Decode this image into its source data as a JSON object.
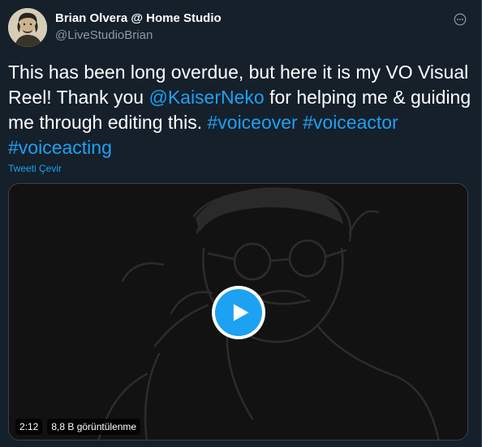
{
  "author": {
    "name": "Brian Olvera @ Home Studio",
    "handle": "@LiveStudioBrian"
  },
  "tweet": {
    "text_before_mention": "This has been long overdue, but here it is my VO Visual Reel! Thank you ",
    "mention": "@KaiserNeko",
    "text_after_mention": " for helping me & guiding me through editing this. ",
    "hashtags": [
      "#voiceover",
      "#voiceactor",
      "#voiceacting"
    ]
  },
  "translate_label": "Tweeti Çevir",
  "video": {
    "duration": "2:12",
    "views": "8,8 B görüntülenme"
  },
  "colors": {
    "background": "#15202b",
    "accent": "#1da1f2",
    "secondary_text": "#8899a6",
    "border": "#38444d"
  },
  "icons": {
    "more": "more-horizontal-icon",
    "play": "play-icon"
  }
}
